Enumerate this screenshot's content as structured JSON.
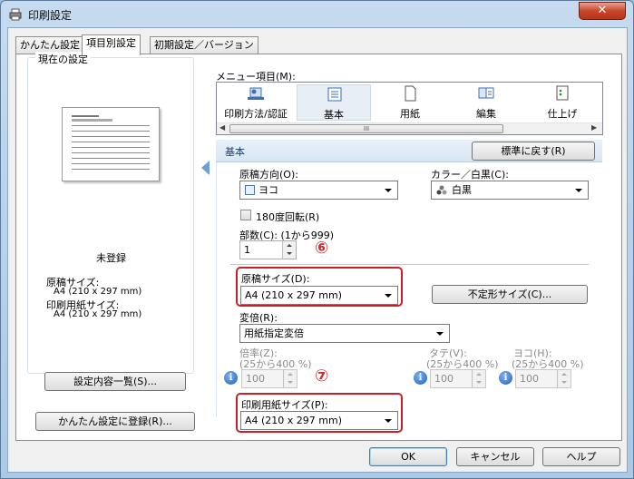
{
  "window": {
    "title": "印刷設定",
    "close_glyph": "✕"
  },
  "tabs": [
    {
      "label": "かんたん設定",
      "active": false
    },
    {
      "label": "項目別設定",
      "active": true
    },
    {
      "label": "初期設定／バージョン",
      "active": false
    }
  ],
  "current_settings": {
    "legend": "現在の設定",
    "status": "未登録",
    "original_size_label": "原稿サイズ:",
    "original_size_value": "A4 (210 x 297 mm)",
    "paper_size_label": "印刷用紙サイズ:",
    "paper_size_value": "A4 (210 x 297 mm)",
    "list_button": "設定内容一覧(S)...",
    "register_button": "かんたん設定に登録(R)..."
  },
  "menu": {
    "label": "メニュー項目(M):",
    "items": [
      {
        "label": "印刷方法/認証",
        "icon": "print-method-icon"
      },
      {
        "label": "基本",
        "icon": "basic-settings-icon",
        "selected": true
      },
      {
        "label": "用紙",
        "icon": "paper-icon"
      },
      {
        "label": "編集",
        "icon": "edit-icon"
      },
      {
        "label": "仕上げ",
        "icon": "finishing-icon"
      }
    ],
    "scroll_grip": "III"
  },
  "section": {
    "title": "基本",
    "reset_button": "標準に戻す(R)"
  },
  "fields": {
    "orientation_label": "原稿方向(O):",
    "orientation_value": "ヨコ",
    "color_label": "カラー／白黒(C):",
    "color_value": "白黒",
    "rotate_label": "180度回転(R)",
    "copies_label": "部数(C): (1から999)",
    "copies_value": "1",
    "original_size_label": "原稿サイズ(D):",
    "original_size_value": "A4 (210 x 297 mm)",
    "custom_size_button": "不定形サイズ(C)...",
    "scale_label": "変倍(R):",
    "scale_value": "用紙指定変倍",
    "ratio_label": "倍率(Z):",
    "ratio_range": "(25から400 %)",
    "ratio_value": "100",
    "vertical_label": "タテ(V):",
    "vertical_range": "(25から400 %)",
    "vertical_value": "100",
    "horizontal_label": "ヨコ(H):",
    "horizontal_range": "(25から400 %)",
    "horizontal_value": "100",
    "paper_size_label": "印刷用紙サイズ(P):",
    "paper_size_value": "A4 (210 x 297 mm)"
  },
  "annotations": {
    "marker_6": "⑥",
    "marker_7": "⑦",
    "highlight_color": "#c8202a"
  },
  "footer": {
    "ok": "OK",
    "cancel": "キャンセル",
    "help": "ヘルプ"
  },
  "info_glyph": "i"
}
